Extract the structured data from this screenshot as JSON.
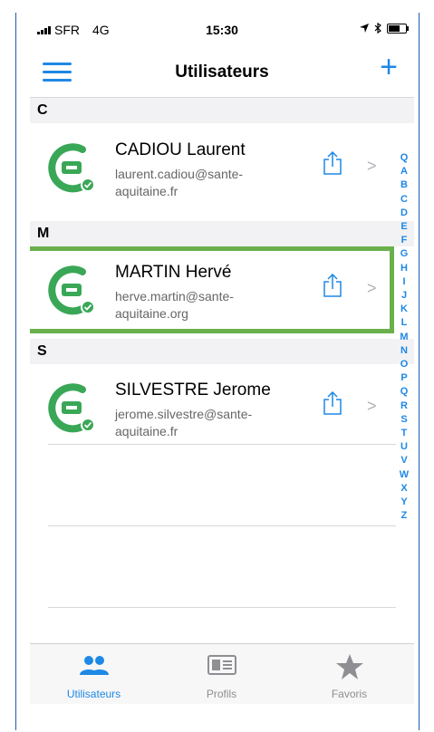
{
  "status_bar": {
    "carrier": "SFR",
    "network": "4G",
    "time": "15:30"
  },
  "navbar": {
    "title": "Utilisateurs"
  },
  "sections": [
    {
      "letter": "C",
      "users": [
        {
          "name": "CADIOU Laurent",
          "email_line1": "laurent.cadiou@sante-",
          "email_line2": "aquitaine.fr"
        }
      ]
    },
    {
      "letter": "M",
      "users": [
        {
          "name": "MARTIN Hervé",
          "email_line1": "herve.martin@sante-",
          "email_line2": "aquitaine.org"
        }
      ]
    },
    {
      "letter": "S",
      "users": [
        {
          "name": "SILVESTRE Jerome",
          "email_line1": "jerome.silvestre@sante-",
          "email_line2": "aquitaine.fr"
        }
      ]
    }
  ],
  "index_letters": [
    "Q",
    "A",
    "B",
    "C",
    "D",
    "E",
    "F",
    "G",
    "H",
    "I",
    "J",
    "K",
    "L",
    "M",
    "N",
    "O",
    "P",
    "Q",
    "R",
    "S",
    "T",
    "U",
    "V",
    "W",
    "X",
    "Y",
    "Z"
  ],
  "tabs": [
    {
      "label": "Utilisateurs",
      "icon": "users-icon",
      "active": true
    },
    {
      "label": "Profils",
      "icon": "id-card-icon",
      "active": false
    },
    {
      "label": "Favoris",
      "icon": "star-icon",
      "active": false
    }
  ],
  "colors": {
    "accent": "#1e88e5",
    "avatar_green": "#3aa757",
    "highlight": "#6ab04c",
    "inactive": "#8e8e93"
  }
}
